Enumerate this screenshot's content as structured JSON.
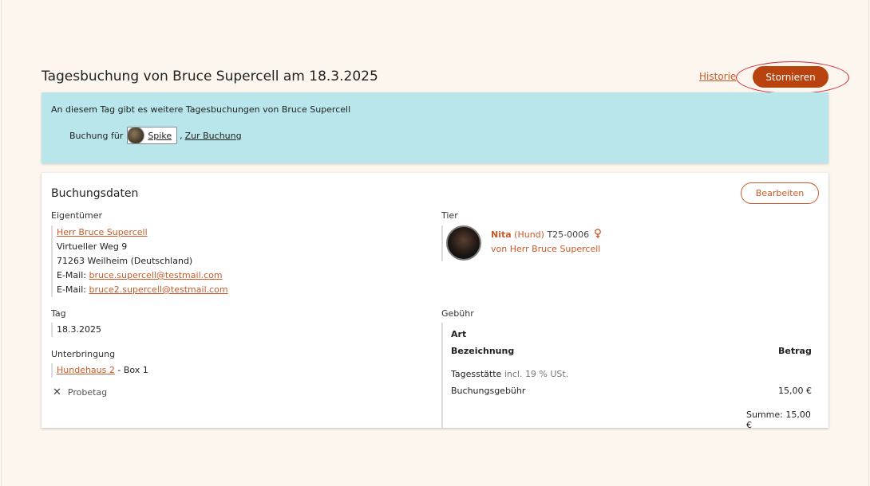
{
  "header": {
    "title": "Tagesbuchung von Bruce Supercell am 18.3.2025",
    "history_link": "Historie",
    "cancel_button": "Stornieren"
  },
  "info_banner": {
    "text": "An diesem Tag gibt es weitere Tagesbuchungen von Bruce Supercell",
    "booking_prefix": "Buchung für",
    "pet_name": "Spike",
    "separator": ",",
    "goto_link": "Zur Buchung"
  },
  "card": {
    "title": "Buchungsdaten",
    "edit_button": "Bearbeiten",
    "owner": {
      "label": "Eigentümer",
      "name": "Herr Bruce Supercell",
      "street": "Virtueller Weg 9",
      "city": "71263 Weilheim (Deutschland)",
      "email_label": "E-Mail:",
      "email1": "bruce.supercell@testmail.com",
      "email2": "bruce2.supercell@testmail.com"
    },
    "animal": {
      "label": "Tier",
      "name": "Nita",
      "species": "(Hund)",
      "id": "T25-0006",
      "owner_line": "von Herr Bruce Supercell"
    },
    "day": {
      "label": "Tag",
      "value": "18.3.2025"
    },
    "housing": {
      "label": "Unterbringung",
      "house": "Hundehaus 2",
      "box": "- Box 1"
    },
    "trial_day": {
      "icon": "x-icon",
      "label": "Probetag"
    },
    "fees": {
      "label": "Gebühr",
      "art_header": "Art",
      "desc_header": "Bezeichnung",
      "amount_header": "Betrag",
      "category": "Tagesstätte",
      "category_note": "incl. 19 % USt.",
      "item_name": "Buchungsgebühr",
      "item_amount": "15,00 €",
      "total": "Summe: 15,00 €"
    }
  },
  "colors": {
    "accent": "#c85a28",
    "cancel_bg": "#b8430f",
    "banner_bg": "#b8e6ea",
    "page_bg": "#fcf6ef",
    "highlight_ring": "#d2242e"
  }
}
